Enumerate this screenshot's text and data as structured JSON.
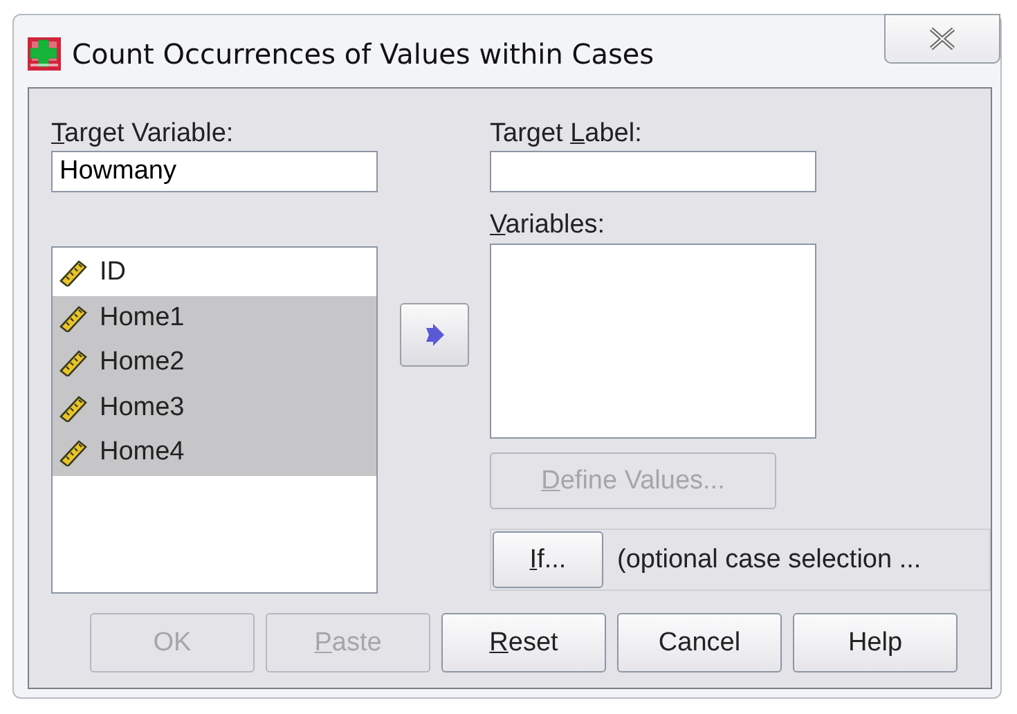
{
  "window": {
    "title": "Count Occurrences of Values within Cases"
  },
  "target_variable": {
    "label": {
      "key": "T",
      "post": "arget Variable:"
    },
    "value": "Howmany"
  },
  "target_label": {
    "label": {
      "pre": "Target ",
      "key": "L",
      "post": "abel:"
    }
  },
  "source_list": {
    "items": [
      {
        "name": "ID",
        "selected": false
      },
      {
        "name": "Home1",
        "selected": true
      },
      {
        "name": "Home2",
        "selected": true
      },
      {
        "name": "Home3",
        "selected": true
      },
      {
        "name": "Home4",
        "selected": true
      }
    ]
  },
  "variables": {
    "label": {
      "key": "V",
      "post": "ariables:"
    }
  },
  "define_values_button": {
    "label": {
      "key": "D",
      "post": "efine Values..."
    },
    "disabled": true
  },
  "if_button": {
    "label": {
      "key": "I",
      "post": "f..."
    },
    "disabled": false
  },
  "if_note": "(optional case selection ...",
  "buttons": [
    {
      "label": {
        "pre": "OK"
      },
      "disabled": true
    },
    {
      "label": {
        "key": "P",
        "post": "aste"
      },
      "disabled": true
    },
    {
      "label": {
        "key": "R",
        "post": "eset"
      },
      "disabled": false
    },
    {
      "label": {
        "pre": "Cancel"
      },
      "disabled": false
    },
    {
      "label": {
        "pre": "Help"
      },
      "disabled": false
    }
  ]
}
